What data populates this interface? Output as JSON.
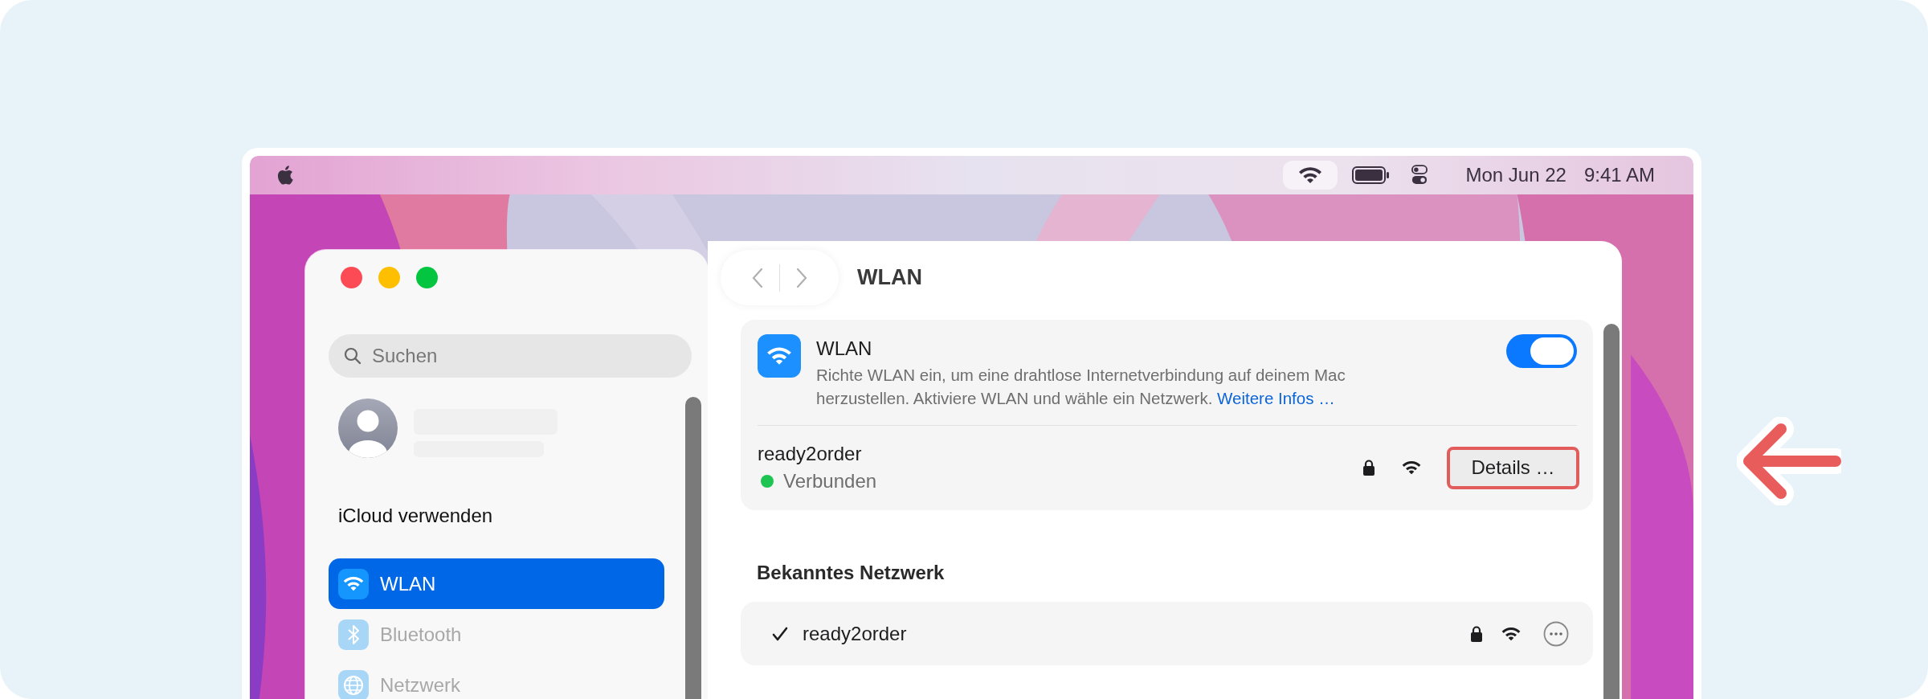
{
  "menu_bar": {
    "date": "Mon Jun 22",
    "time": "9:41 AM"
  },
  "sidebar": {
    "search": {
      "placeholder": "Suchen"
    },
    "icloud_label": "iCloud verwenden",
    "items": [
      {
        "label": "WLAN",
        "kind": "wifi",
        "selected": true
      },
      {
        "label": "Bluetooth",
        "kind": "bluetooth",
        "selected": false
      },
      {
        "label": "Netzwerk",
        "kind": "globe",
        "selected": false
      }
    ]
  },
  "main": {
    "title": "WLAN",
    "wlan_card": {
      "title": "WLAN",
      "description": "Richte WLAN ein, um eine drahtlose Internetverbindung auf deinem Mac herzustellen. Aktiviere WLAN und wähle ein Netzwerk.",
      "link": "Weitere Infos …",
      "on": true
    },
    "current_network": {
      "name": "ready2order",
      "status": "Verbunden",
      "connected": true,
      "locked": true,
      "button": "Details …",
      "highlighted": true
    },
    "known_section": {
      "title": "Bekanntes Netzwerk",
      "networks": [
        {
          "name": "ready2order",
          "checked": true,
          "locked": true
        }
      ]
    }
  }
}
